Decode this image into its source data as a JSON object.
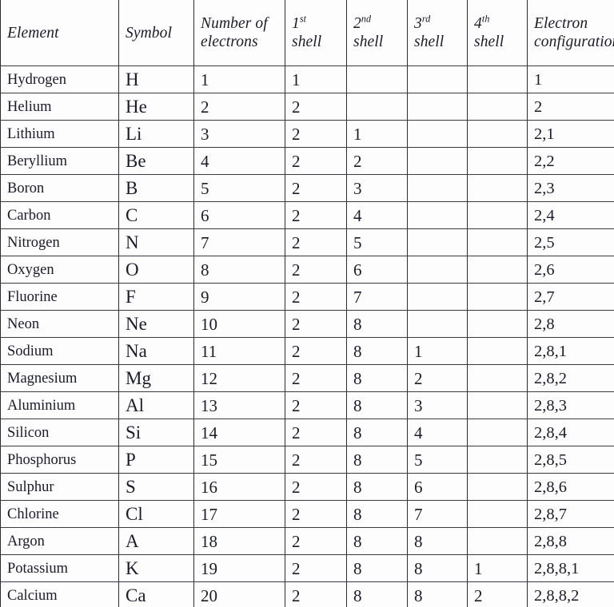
{
  "table": {
    "columns": [
      {
        "key": "element",
        "label": "Element",
        "sup": ""
      },
      {
        "key": "symbol",
        "label": "Symbol",
        "sup": ""
      },
      {
        "key": "number",
        "label": "Number of electrons",
        "sup": ""
      },
      {
        "key": "shell1",
        "label": "shell",
        "sup": "st",
        "prefix": "1"
      },
      {
        "key": "shell2",
        "label": "shell",
        "sup": "nd",
        "prefix": "2"
      },
      {
        "key": "shell3",
        "label": "shell",
        "sup": "rd",
        "prefix": "3"
      },
      {
        "key": "shell4",
        "label": "shell",
        "sup": "th",
        "prefix": "4"
      },
      {
        "key": "config",
        "label": "Electron configuration",
        "sup": ""
      }
    ],
    "rows": [
      {
        "element": "Hydrogen",
        "symbol": "H",
        "number": "1",
        "shell1": "1",
        "shell2": "",
        "shell3": "",
        "shell4": "",
        "config": "1"
      },
      {
        "element": "Helium",
        "symbol": "He",
        "number": "2",
        "shell1": "2",
        "shell2": "",
        "shell3": "",
        "shell4": "",
        "config": "2"
      },
      {
        "element": "Lithium",
        "symbol": "Li",
        "number": "3",
        "shell1": "2",
        "shell2": "1",
        "shell3": "",
        "shell4": "",
        "config": "2,1"
      },
      {
        "element": "Beryllium",
        "symbol": "Be",
        "number": "4",
        "shell1": "2",
        "shell2": "2",
        "shell3": "",
        "shell4": "",
        "config": "2,2"
      },
      {
        "element": "Boron",
        "symbol": "B",
        "number": "5",
        "shell1": "2",
        "shell2": "3",
        "shell3": "",
        "shell4": "",
        "config": "2,3"
      },
      {
        "element": "Carbon",
        "symbol": "C",
        "number": "6",
        "shell1": "2",
        "shell2": "4",
        "shell3": "",
        "shell4": "",
        "config": "2,4"
      },
      {
        "element": "Nitrogen",
        "symbol": "N",
        "number": "7",
        "shell1": "2",
        "shell2": "5",
        "shell3": "",
        "shell4": "",
        "config": "2,5"
      },
      {
        "element": "Oxygen",
        "symbol": "O",
        "number": "8",
        "shell1": "2",
        "shell2": "6",
        "shell3": "",
        "shell4": "",
        "config": "2,6"
      },
      {
        "element": "Fluorine",
        "symbol": "F",
        "number": "9",
        "shell1": "2",
        "shell2": "7",
        "shell3": "",
        "shell4": "",
        "config": "2,7"
      },
      {
        "element": "Neon",
        "symbol": "Ne",
        "number": "10",
        "shell1": "2",
        "shell2": "8",
        "shell3": "",
        "shell4": "",
        "config": "2,8"
      },
      {
        "element": "Sodium",
        "symbol": "Na",
        "number": "11",
        "shell1": "2",
        "shell2": "8",
        "shell3": "1",
        "shell4": "",
        "config": "2,8,1"
      },
      {
        "element": "Magnesium",
        "symbol": "Mg",
        "number": "12",
        "shell1": "2",
        "shell2": "8",
        "shell3": "2",
        "shell4": "",
        "config": "2,8,2"
      },
      {
        "element": "Aluminium",
        "symbol": "Al",
        "number": "13",
        "shell1": "2",
        "shell2": "8",
        "shell3": "3",
        "shell4": "",
        "config": "2,8,3"
      },
      {
        "element": "Silicon",
        "symbol": "Si",
        "number": "14",
        "shell1": "2",
        "shell2": "8",
        "shell3": "4",
        "shell4": "",
        "config": "2,8,4"
      },
      {
        "element": "Phosphorus",
        "symbol": "P",
        "number": "15",
        "shell1": "2",
        "shell2": "8",
        "shell3": "5",
        "shell4": "",
        "config": "2,8,5"
      },
      {
        "element": "Sulphur",
        "symbol": "S",
        "number": "16",
        "shell1": "2",
        "shell2": "8",
        "shell3": "6",
        "shell4": "",
        "config": "2,8,6"
      },
      {
        "element": "Chlorine",
        "symbol": "Cl",
        "number": "17",
        "shell1": "2",
        "shell2": "8",
        "shell3": "7",
        "shell4": "",
        "config": "2,8,7"
      },
      {
        "element": "Argon",
        "symbol": "A",
        "number": "18",
        "shell1": "2",
        "shell2": "8",
        "shell3": "8",
        "shell4": "",
        "config": "2,8,8"
      },
      {
        "element": "Potassium",
        "symbol": "K",
        "number": "19",
        "shell1": "2",
        "shell2": "8",
        "shell3": "8",
        "shell4": "1",
        "config": "2,8,8,1"
      },
      {
        "element": "Calcium",
        "symbol": "Ca",
        "number": "20",
        "shell1": "2",
        "shell2": "8",
        "shell3": "8",
        "shell4": "2",
        "config": "2,8,8,2"
      }
    ]
  },
  "colors": {
    "background": "#fdfdfd",
    "border": "#2b2b33",
    "text": "#1b1b2b"
  }
}
